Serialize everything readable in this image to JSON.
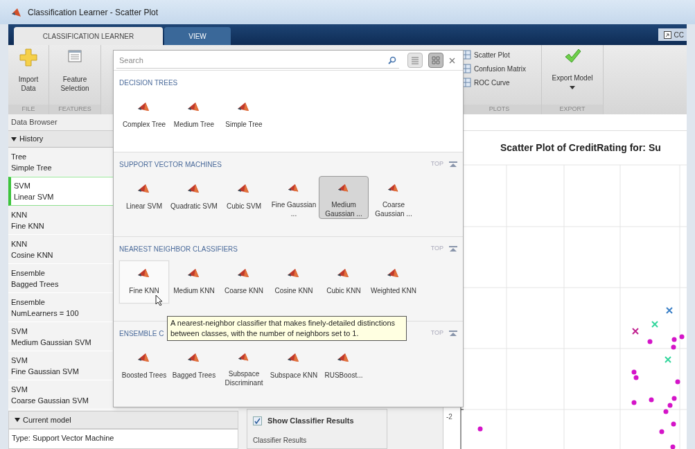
{
  "window": {
    "title": "Classification Learner - Scatter Plot"
  },
  "tabs": [
    {
      "label": "CLASSIFICATION LEARNER",
      "selected": true
    },
    {
      "label": "VIEW",
      "selected": false
    }
  ],
  "corner_button": {
    "label": "CC"
  },
  "ribbon": {
    "groups": [
      {
        "label": "FILE",
        "items": [
          {
            "kind": "import",
            "label": "Import Data"
          }
        ]
      },
      {
        "label": "FEATURES",
        "items": [
          {
            "kind": "features",
            "label": "Feature Selection"
          }
        ]
      },
      {
        "label": "PLOTS",
        "items": [
          {
            "kind": "plot",
            "label": "Scatter Plot"
          },
          {
            "kind": "plot",
            "label": "Confusion Matrix"
          },
          {
            "kind": "plot",
            "label": "ROC Curve"
          }
        ]
      },
      {
        "label": "EXPORT",
        "items": [
          {
            "kind": "export",
            "label": "Export Model"
          }
        ]
      }
    ]
  },
  "data_browser": {
    "title": "Data Browser",
    "history": {
      "title": "History",
      "expanded": true,
      "items": [
        {
          "type": "Tree",
          "name": "Simple Tree",
          "selected": false
        },
        {
          "type": "SVM",
          "name": "Linear SVM",
          "selected": true
        },
        {
          "type": "KNN",
          "name": "Fine KNN",
          "selected": false
        },
        {
          "type": "KNN",
          "name": "Cosine KNN",
          "selected": false
        },
        {
          "type": "Ensemble",
          "name": "Bagged Trees",
          "selected": false
        },
        {
          "type": "Ensemble",
          "name": "NumLearners = 100",
          "selected": false
        },
        {
          "type": "SVM",
          "name": "Medium Gaussian SVM",
          "selected": false
        },
        {
          "type": "SVM",
          "name": "Fine Gaussian SVM",
          "selected": false
        },
        {
          "type": "SVM",
          "name": "Coarse Gaussian SVM",
          "selected": false
        }
      ]
    },
    "current_model": {
      "title": "Current model",
      "expanded": true,
      "lines": [
        "Type: Support Vector Machine"
      ]
    }
  },
  "gallery": {
    "search": {
      "placeholder": "Search"
    },
    "views": [
      {
        "kind": "list",
        "selected": false
      },
      {
        "kind": "grid",
        "selected": true
      }
    ],
    "sections": [
      {
        "title": "DECISION TREES",
        "items": [
          {
            "label": "Complex Tree",
            "selected": false,
            "hovered": false
          },
          {
            "label": "Medium Tree",
            "selected": false,
            "hovered": false
          },
          {
            "label": "Simple Tree",
            "selected": false,
            "hovered": false
          }
        ]
      },
      {
        "title": "SUPPORT VECTOR MACHINES",
        "top_link": "TOP",
        "items": [
          {
            "label": "Linear SVM",
            "selected": false,
            "hovered": false
          },
          {
            "label": "Quadratic SVM",
            "selected": false,
            "hovered": false
          },
          {
            "label": "Cubic SVM",
            "selected": false,
            "hovered": false
          },
          {
            "label": "Fine Gaussian ...",
            "selected": false,
            "hovered": false
          },
          {
            "label": "Medium Gaussian ...",
            "selected": true,
            "hovered": false
          },
          {
            "label": "Coarse Gaussian ...",
            "selected": false,
            "hovered": false
          }
        ]
      },
      {
        "title": "NEAREST NEIGHBOR CLASSIFIERS",
        "top_link": "TOP",
        "items": [
          {
            "label": "Fine KNN",
            "selected": false,
            "hovered": true
          },
          {
            "label": "Medium KNN",
            "selected": false,
            "hovered": false
          },
          {
            "label": "Coarse KNN",
            "selected": false,
            "hovered": false
          },
          {
            "label": "Cosine KNN",
            "selected": false,
            "hovered": false
          },
          {
            "label": "Cubic KNN",
            "selected": false,
            "hovered": false
          },
          {
            "label": "Weighted KNN",
            "selected": false,
            "hovered": false
          }
        ]
      },
      {
        "title": "ENSEMBLE C",
        "top_link": "TOP",
        "items": [
          {
            "label": "Boosted Trees",
            "selected": false,
            "hovered": false
          },
          {
            "label": "Bagged Trees",
            "selected": false,
            "hovered": false
          },
          {
            "label": "Subspace Discriminant",
            "selected": false,
            "hovered": false
          },
          {
            "label": "Subspace KNN",
            "selected": false,
            "hovered": false
          },
          {
            "label": "RUSBoost...",
            "selected": false,
            "hovered": false
          }
        ]
      }
    ],
    "tooltip": "A nearest-neighbor classifier that makes finely-detailed distinctions between classes, with the number of neighbors set to 1."
  },
  "classifier_panel": {
    "show_results": {
      "label": "Show Classifier Results",
      "checked": true
    },
    "group_label": "Classifier Results"
  },
  "plot": {
    "title": "Scatter Plot of CreditRating for: Su",
    "tick_label": "-2"
  }
}
